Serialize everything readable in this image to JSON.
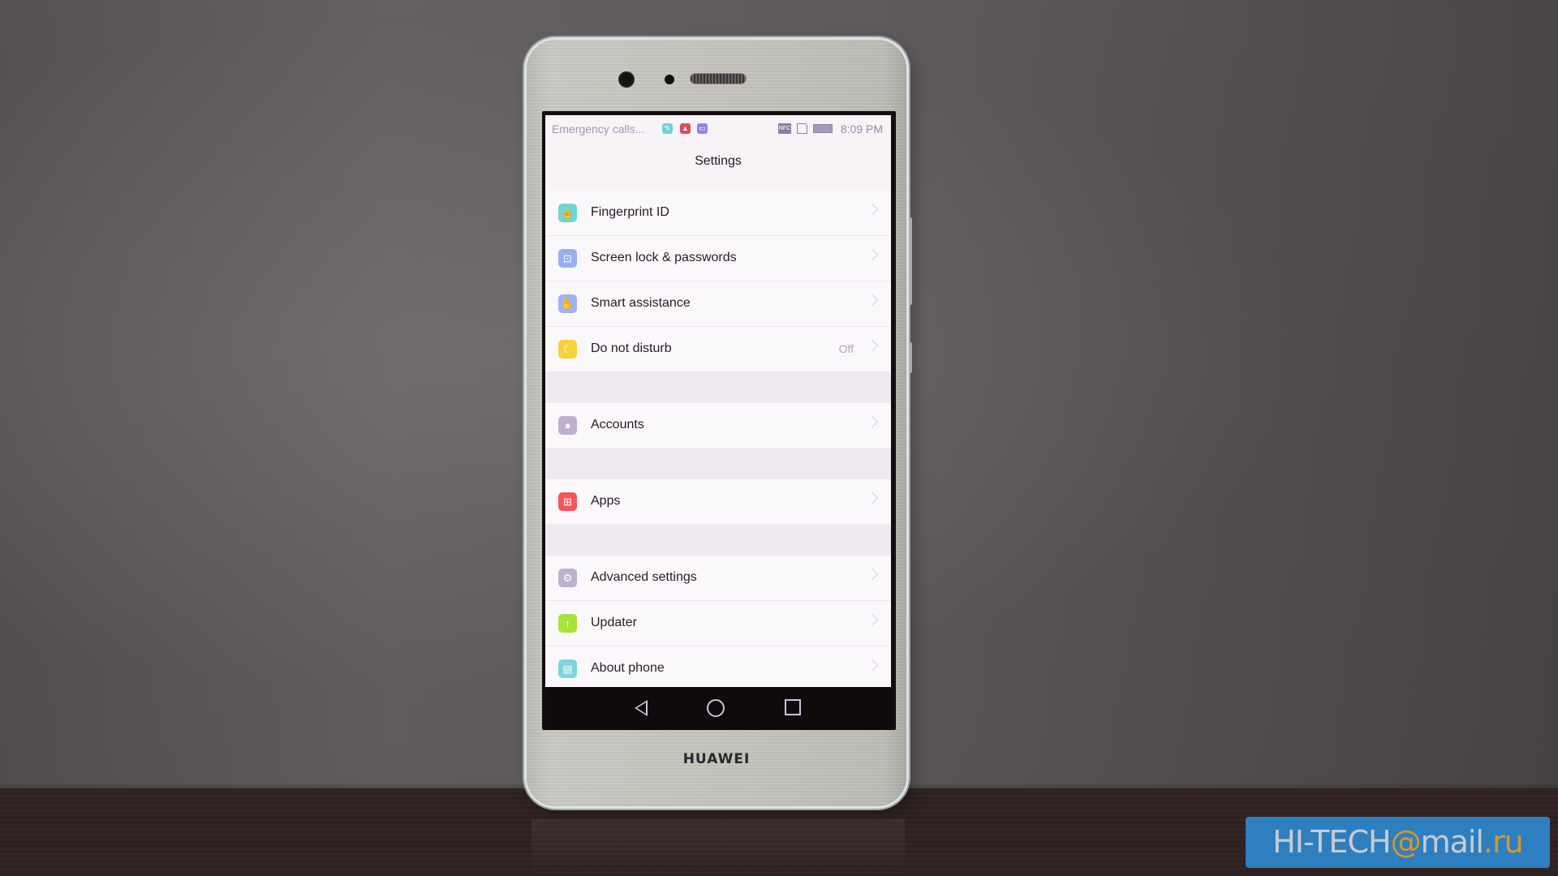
{
  "status_bar": {
    "carrier_text": "Emergency calls...",
    "notification_icons": [
      {
        "name": "edit-note-icon",
        "color": "#6fd3dc"
      },
      {
        "name": "warning-icon",
        "color": "#e2495f"
      },
      {
        "name": "document-icon",
        "color": "#8a86e8"
      }
    ],
    "system_icons": [
      {
        "name": "nfc-icon",
        "label": "NFC"
      },
      {
        "name": "sim-card-icon"
      },
      {
        "name": "battery-icon"
      }
    ],
    "time": "8:09 PM"
  },
  "header": {
    "title": "Settings"
  },
  "settings": {
    "groups": [
      {
        "items": [
          {
            "label": "Fingerprint ID",
            "icon": "fingerprint-icon",
            "icon_color": "#6fd6d6",
            "glyph": "☝"
          },
          {
            "label": "Screen lock & passwords",
            "icon": "lock-icon",
            "icon_color": "#98b0f2",
            "glyph": "🔓"
          },
          {
            "label": "Smart assistance",
            "icon": "hand-icon",
            "icon_color": "#9fb3f3",
            "glyph": "✋"
          },
          {
            "label": "Do not disturb",
            "icon": "moon-icon",
            "icon_color": "#f8d23a",
            "glyph": "☾",
            "value": "Off"
          }
        ]
      },
      {
        "items": [
          {
            "label": "Accounts",
            "icon": "user-icon",
            "icon_color": "#bdb0d3",
            "glyph": "👤"
          }
        ]
      },
      {
        "items": [
          {
            "label": "Apps",
            "icon": "apps-grid-icon",
            "icon_color": "#f2575b",
            "glyph": "⊞"
          }
        ]
      },
      {
        "items": [
          {
            "label": "Advanced settings",
            "icon": "gear-icon",
            "icon_color": "#bcb1d2",
            "glyph": "⚙"
          },
          {
            "label": "Updater",
            "icon": "arrow-up-icon",
            "icon_color": "#a8e23a",
            "glyph": "↑"
          },
          {
            "label": "About phone",
            "icon": "phone-info-icon",
            "icon_color": "#7fd4dc",
            "glyph": "▤"
          }
        ]
      }
    ]
  },
  "nav_bar": {
    "back": "back-icon",
    "home": "home-icon",
    "recents": "recents-icon"
  },
  "device": {
    "brand": "HUAWEI"
  },
  "watermark": {
    "prefix": "HI-TECH",
    "at": "@",
    "mail": "mail",
    "dot": ".ru"
  }
}
